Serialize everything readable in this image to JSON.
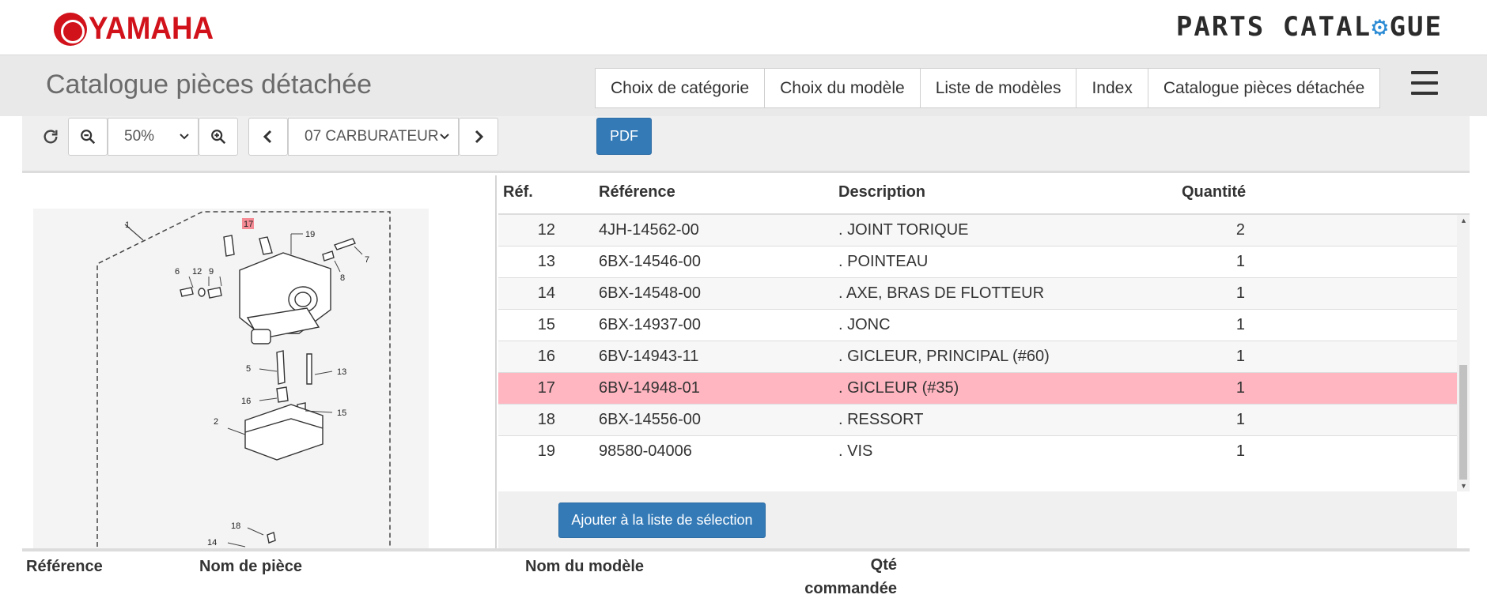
{
  "brand": {
    "yamaha": "YAMAHA",
    "parts_catalogue_a": "PARTS CATAL",
    "parts_catalogue_b": "GUE"
  },
  "header": {
    "title": "Catalogue pièces détachée",
    "tabs": [
      {
        "label": "Choix de catégorie"
      },
      {
        "label": "Choix du modèle"
      },
      {
        "label": "Liste de modèles"
      },
      {
        "label": "Index"
      },
      {
        "label": "Catalogue pièces détachée"
      }
    ]
  },
  "toolbar": {
    "zoom_value": "50%",
    "section_value": "07 CARBURATEUR",
    "pdf_label": "PDF"
  },
  "table": {
    "headers": {
      "ref": "Réf.",
      "reference": "Référence",
      "description": "Description",
      "quantity": "Quantité"
    },
    "rows": [
      {
        "ref": "12",
        "reference": "4JH-14562-00",
        "description": ". JOINT TORIQUE",
        "qty": "2",
        "selected": false
      },
      {
        "ref": "13",
        "reference": "6BX-14546-00",
        "description": ". POINTEAU",
        "qty": "1",
        "selected": false
      },
      {
        "ref": "14",
        "reference": "6BX-14548-00",
        "description": ". AXE, BRAS DE FLOTTEUR",
        "qty": "1",
        "selected": false
      },
      {
        "ref": "15",
        "reference": "6BX-14937-00",
        "description": ". JONC",
        "qty": "1",
        "selected": false
      },
      {
        "ref": "16",
        "reference": "6BV-14943-11",
        "description": ". GICLEUR, PRINCIPAL (#60)",
        "qty": "1",
        "selected": false
      },
      {
        "ref": "17",
        "reference": "6BV-14948-01",
        "description": ". GICLEUR (#35)",
        "qty": "1",
        "selected": true
      },
      {
        "ref": "18",
        "reference": "6BX-14556-00",
        "description": ". RESSORT",
        "qty": "1",
        "selected": false
      },
      {
        "ref": "19",
        "reference": "98580-04006",
        "description": ". VIS",
        "qty": "1",
        "selected": false
      }
    ],
    "add_button": "Ajouter à la liste de sélection"
  },
  "diagram": {
    "callouts": [
      "1",
      "17",
      "19",
      "7",
      "8",
      "6",
      "12",
      "9",
      "5",
      "13",
      "16",
      "15",
      "2",
      "18",
      "14"
    ],
    "highlighted": "17"
  },
  "selection_list": {
    "headers": {
      "reference": "Référence",
      "part_name": "Nom de pièce",
      "model_name": "Nom du modèle",
      "qty_line1": "Qté",
      "qty_line2": "commandée"
    }
  },
  "colors": {
    "brand_red": "#d1121b",
    "accent_blue": "#337ab7",
    "selected_row": "#ffb6c1",
    "highlight_callout": "#f48b95"
  }
}
